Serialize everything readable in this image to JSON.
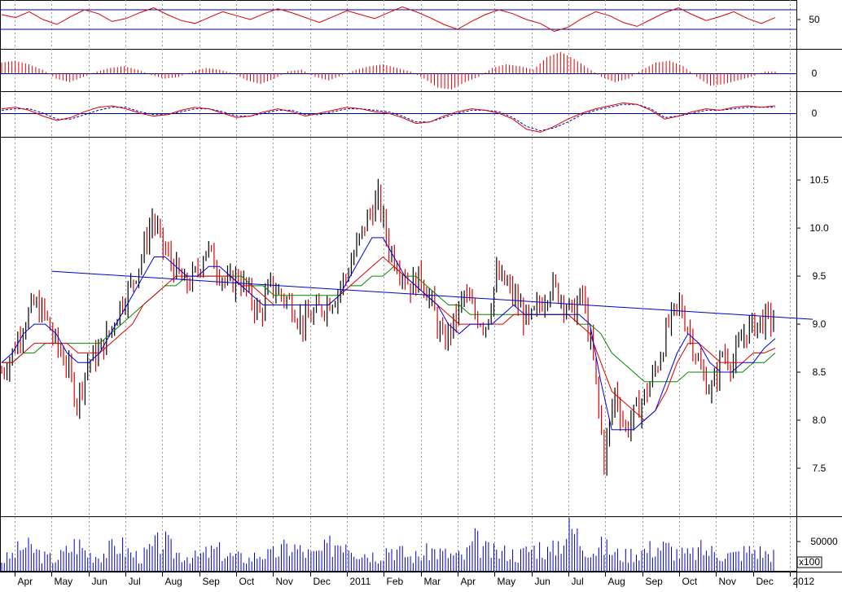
{
  "chart_data": {
    "type": "line",
    "kind": "stock-candlestick-with-indicators",
    "title": "",
    "colors": {
      "candle_up": "#000000",
      "candle_down": "#dd0000",
      "ma_fast": "#0000dd",
      "ma_mid": "#dd0000",
      "ma_slow": "#008800",
      "trendline": "#0000cc",
      "volume": "#0000cc",
      "osc": "#dd0000",
      "ref_line": "#0000aa",
      "grid": "#999999"
    },
    "x_axis": {
      "months": [
        "Apr",
        "May",
        "Jun",
        "Jul",
        "Aug",
        "Sep",
        "Oct",
        "Nov",
        "Dec",
        "2011",
        "Feb",
        "Mar",
        "Apr",
        "May",
        "Jun",
        "Jul",
        "Aug",
        "Sep",
        "Oct",
        "Nov",
        "Dec",
        "2012"
      ],
      "grid": "dashed"
    },
    "panels": {
      "rsi": {
        "ticks": [
          "50"
        ],
        "reference_lines": [
          60,
          40
        ],
        "values": [
          55,
          52,
          58,
          50,
          45,
          53,
          60,
          56,
          48,
          51,
          57,
          62,
          55,
          49,
          46,
          52,
          58,
          54,
          50,
          56,
          61,
          57,
          52,
          47,
          53,
          59,
          55,
          51,
          57,
          63,
          58,
          52,
          45,
          40,
          48,
          55,
          60,
          56,
          50,
          46,
          38,
          42,
          51,
          58,
          54,
          47,
          43,
          50,
          57,
          62,
          55,
          49,
          53,
          58,
          51,
          46,
          52
        ]
      },
      "histogram": {
        "ticks": [
          "0"
        ],
        "reference_line": 0,
        "values": [
          0.6,
          0.7,
          0.5,
          0.2,
          -0.3,
          -0.5,
          -0.2,
          0.1,
          0.3,
          0.4,
          0.2,
          -0.1,
          -0.3,
          -0.2,
          0.1,
          0.3,
          0.2,
          0.0,
          -0.4,
          -0.6,
          -0.3,
          0.1,
          0.2,
          -0.2,
          -0.4,
          -0.1,
          0.2,
          0.4,
          0.5,
          0.3,
          0.1,
          -0.3,
          -0.8,
          -0.9,
          -0.5,
          -0.2,
          0.3,
          0.5,
          0.4,
          0.2,
          0.9,
          1.2,
          0.8,
          0.3,
          -0.2,
          -0.5,
          -0.3,
          0.2,
          0.6,
          0.7,
          0.4,
          -0.2,
          -0.7,
          -0.6,
          -0.4,
          -0.2,
          0.1
        ]
      },
      "macd": {
        "ticks": [
          "0"
        ],
        "reference_line": 0,
        "line": [
          0.3,
          0.4,
          0.2,
          -0.2,
          -0.5,
          -0.3,
          0.1,
          0.4,
          0.5,
          0.3,
          0.0,
          -0.2,
          -0.1,
          0.2,
          0.4,
          0.3,
          0.0,
          -0.3,
          -0.2,
          0.1,
          0.3,
          0.1,
          -0.2,
          0.0,
          0.2,
          0.4,
          0.3,
          0.1,
          0.0,
          -0.3,
          -0.7,
          -0.6,
          -0.2,
          0.1,
          0.3,
          0.2,
          0.0,
          -0.4,
          -1.1,
          -1.3,
          -0.9,
          -0.4,
          0.0,
          0.3,
          0.5,
          0.7,
          0.6,
          0.2,
          -0.4,
          -0.2,
          0.1,
          0.3,
          0.2,
          0.4,
          0.5,
          0.4,
          0.5
        ],
        "signal": [
          0.2,
          0.3,
          0.3,
          0.0,
          -0.4,
          -0.4,
          -0.1,
          0.2,
          0.4,
          0.4,
          0.1,
          -0.1,
          -0.1,
          0.1,
          0.3,
          0.3,
          0.1,
          -0.2,
          -0.2,
          0.0,
          0.2,
          0.2,
          -0.1,
          -0.1,
          0.1,
          0.3,
          0.3,
          0.2,
          0.1,
          -0.2,
          -0.6,
          -0.6,
          -0.3,
          0.0,
          0.2,
          0.2,
          0.1,
          -0.3,
          -0.9,
          -1.2,
          -1.0,
          -0.6,
          -0.1,
          0.2,
          0.4,
          0.6,
          0.6,
          0.3,
          -0.3,
          -0.2,
          0.0,
          0.2,
          0.2,
          0.3,
          0.4,
          0.4,
          0.4
        ]
      },
      "price": {
        "ticks": [
          "10.5",
          "10.0",
          "9.5",
          "9.0",
          "8.5",
          "8.0",
          "7.5"
        ],
        "tick_values": [
          10.5,
          10.0,
          9.5,
          9.0,
          8.5,
          8.0,
          7.5
        ],
        "ylim": [
          7.0,
          10.95
        ],
        "close": [
          8.5,
          8.7,
          9.0,
          9.2,
          9.1,
          8.8,
          8.6,
          8.2,
          8.6,
          8.7,
          8.9,
          9.2,
          9.4,
          9.7,
          10.1,
          9.8,
          9.6,
          9.4,
          9.5,
          9.8,
          9.6,
          9.4,
          9.5,
          9.3,
          9.1,
          9.4,
          9.3,
          9.2,
          9.0,
          9.1,
          9.2,
          9.3,
          9.5,
          9.8,
          10.1,
          10.3,
          9.8,
          9.6,
          9.4,
          9.5,
          9.2,
          8.8,
          9.0,
          9.3,
          9.1,
          9.0,
          9.5,
          9.4,
          9.2,
          9.0,
          9.2,
          9.4,
          9.3,
          9.1,
          9.3,
          8.6,
          7.6,
          8.3,
          7.9,
          8.1,
          8.3,
          8.6,
          9.0,
          9.2,
          8.9,
          8.5,
          8.3,
          8.7,
          8.6,
          8.9,
          9.0,
          9.05
        ],
        "ma_fast": [
          8.6,
          8.7,
          8.9,
          9.0,
          9.0,
          8.9,
          8.7,
          8.6,
          8.6,
          8.7,
          8.9,
          9.1,
          9.3,
          9.5,
          9.7,
          9.7,
          9.6,
          9.5,
          9.5,
          9.6,
          9.6,
          9.5,
          9.4,
          9.3,
          9.2,
          9.2,
          9.2,
          9.2,
          9.2,
          9.2,
          9.2,
          9.3,
          9.5,
          9.7,
          9.9,
          9.9,
          9.7,
          9.5,
          9.4,
          9.3,
          9.2,
          9.0,
          8.9,
          9.0,
          9.0,
          9.0,
          9.1,
          9.2,
          9.1,
          9.1,
          9.1,
          9.1,
          9.1,
          9.1,
          9.0,
          8.4,
          7.9,
          7.9,
          7.9,
          8.0,
          8.1,
          8.4,
          8.7,
          8.9,
          8.8,
          8.6,
          8.5,
          8.5,
          8.6,
          8.6,
          8.75,
          8.85
        ],
        "ma_mid": [
          8.6,
          8.6,
          8.7,
          8.8,
          8.8,
          8.8,
          8.8,
          8.7,
          8.7,
          8.7,
          8.8,
          8.9,
          9.0,
          9.2,
          9.3,
          9.4,
          9.5,
          9.5,
          9.5,
          9.5,
          9.5,
          9.5,
          9.4,
          9.4,
          9.3,
          9.2,
          9.2,
          9.2,
          9.2,
          9.2,
          9.2,
          9.3,
          9.4,
          9.5,
          9.6,
          9.7,
          9.6,
          9.5,
          9.4,
          9.3,
          9.2,
          9.1,
          9.0,
          9.0,
          9.0,
          9.0,
          9.0,
          9.1,
          9.1,
          9.1,
          9.1,
          9.1,
          9.1,
          9.0,
          8.9,
          8.6,
          8.3,
          8.2,
          8.1,
          8.0,
          8.1,
          8.3,
          8.6,
          8.8,
          8.8,
          8.7,
          8.6,
          8.6,
          8.6,
          8.7,
          8.7,
          8.75
        ],
        "ma_slow": [
          8.6,
          8.6,
          8.7,
          8.7,
          8.8,
          8.8,
          8.8,
          8.8,
          8.8,
          8.8,
          8.9,
          9.0,
          9.1,
          9.2,
          9.3,
          9.4,
          9.4,
          9.5,
          9.5,
          9.5,
          9.5,
          9.5,
          9.5,
          9.4,
          9.4,
          9.3,
          9.3,
          9.3,
          9.3,
          9.3,
          9.3,
          9.3,
          9.4,
          9.4,
          9.5,
          9.5,
          9.6,
          9.5,
          9.5,
          9.4,
          9.3,
          9.2,
          9.2,
          9.1,
          9.1,
          9.1,
          9.1,
          9.1,
          9.1,
          9.1,
          9.1,
          9.1,
          9.1,
          9.0,
          9.0,
          8.9,
          8.7,
          8.6,
          8.5,
          8.4,
          8.4,
          8.4,
          8.4,
          8.5,
          8.5,
          8.5,
          8.5,
          8.5,
          8.5,
          8.6,
          8.6,
          8.7
        ],
        "trendline": {
          "from": [
            "May",
            9.55
          ],
          "to": [
            "2012",
            9.05
          ]
        }
      },
      "volume": {
        "ticks": [
          "50000"
        ],
        "multiplier_label": "x100",
        "values": [
          30,
          45,
          70,
          60,
          40,
          35,
          55,
          80,
          50,
          45,
          60,
          75,
          50,
          40,
          65,
          85,
          55,
          45,
          40,
          50,
          60,
          45,
          40,
          35,
          50,
          45,
          60,
          70,
          55,
          45,
          60,
          80,
          95,
          60,
          50,
          45,
          70,
          55,
          40,
          45,
          60,
          50,
          45,
          40,
          85,
          60,
          50,
          55,
          45,
          60,
          70,
          50,
          90,
          120,
          80,
          60,
          70,
          50,
          45,
          55,
          60,
          70,
          65,
          50,
          45,
          60,
          55,
          50,
          45,
          55,
          60,
          50
        ]
      }
    }
  }
}
